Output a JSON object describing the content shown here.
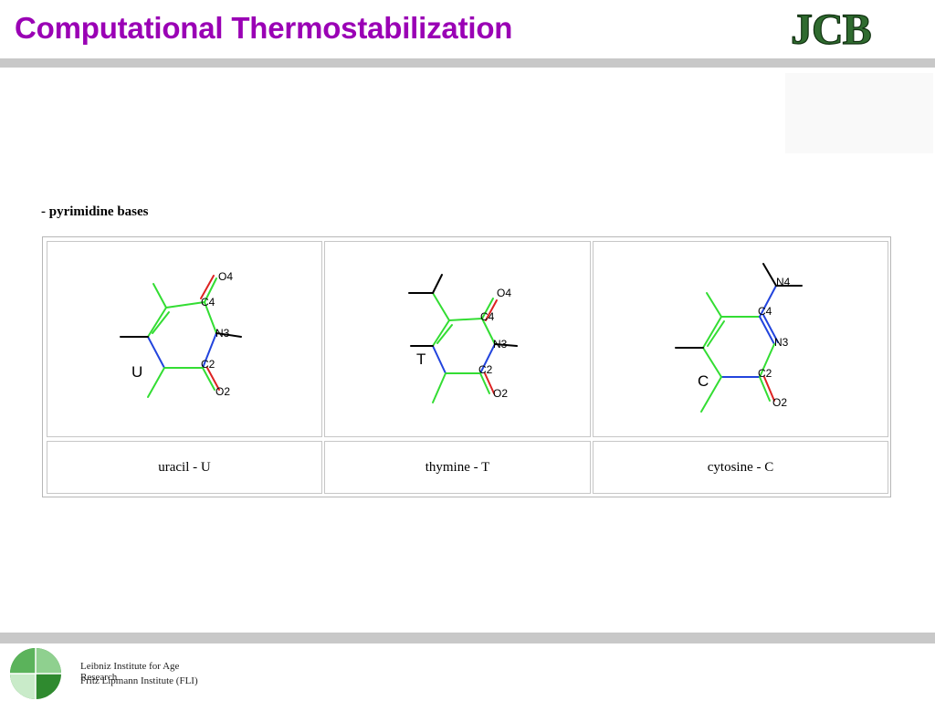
{
  "slide": {
    "title": "Computational Thermostabilization",
    "logo_text": "JCB",
    "section_label": "- pyrimidine bases"
  },
  "bases": [
    {
      "caption": "uracil - U",
      "letter": "U",
      "atoms": [
        "O4",
        "C4",
        "N3",
        "C2",
        "O2"
      ]
    },
    {
      "caption": "thymine - T",
      "letter": "T",
      "atoms": [
        "O4",
        "C4",
        "N3",
        "C2",
        "O2"
      ]
    },
    {
      "caption": "cytosine - C",
      "letter": "C",
      "atoms": [
        "N4",
        "C4",
        "N3",
        "C2",
        "O2"
      ]
    }
  ],
  "footer": {
    "line1": "Leibniz Institute for Age Research",
    "line2": "Fritz Lipmann Institute (FLI)"
  },
  "colors": {
    "title": "#9a00b5",
    "carbon_bond": "#33dd33",
    "nitrogen_bond": "#2244dd",
    "oxygen_bond": "#dd2222",
    "logo_green": "#2f6b2f"
  }
}
